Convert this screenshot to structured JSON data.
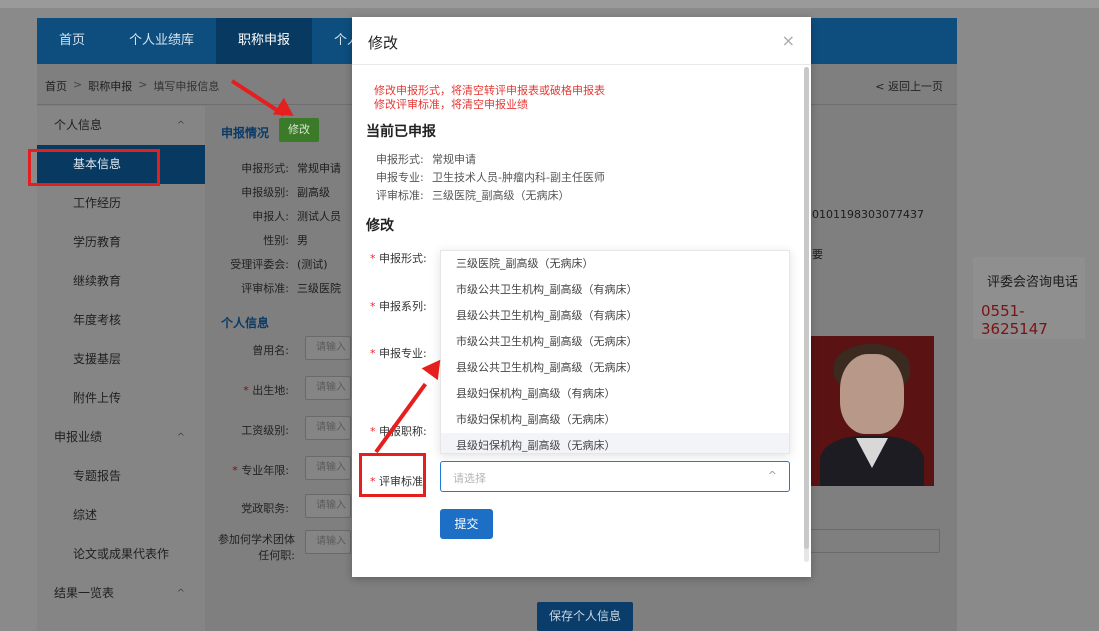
{
  "nav": {
    "items": [
      "首页",
      "个人业绩库",
      "职称申报",
      "个人中心"
    ],
    "active_index": 2
  },
  "breadcrumb": {
    "home": "首页",
    "sep": ">",
    "section": "职称申报",
    "current": "填写申报信息"
  },
  "back_link": "< 返回上一页",
  "sidebar": {
    "groups": [
      {
        "label": "个人信息",
        "chevron": "^",
        "items": [
          "基本信息",
          "工作经历",
          "学历教育",
          "继续教育",
          "年度考核",
          "支援基层",
          "附件上传"
        ]
      },
      {
        "label": "申报业绩",
        "chevron": "^",
        "items": [
          "专题报告",
          "综述",
          "论文或成果代表作"
        ]
      },
      {
        "label": "结果一览表",
        "chevron": "^",
        "items": []
      }
    ],
    "active_item": "基本信息"
  },
  "main": {
    "section_title": "申报情况",
    "edit_button": "修改",
    "fields": [
      {
        "label": "申报形式:",
        "value": "常规申请"
      },
      {
        "label": "申报级别:",
        "value": "副高级"
      },
      {
        "label": "申报人:",
        "value": "测试人员"
      },
      {
        "label": "性别:",
        "value": "男"
      },
      {
        "label": "受理评委会:",
        "value": "(测试)"
      },
      {
        "label": "评审标准:",
        "value": "三级医院"
      }
    ],
    "personal_title": "个人信息",
    "personal_fields": [
      {
        "label": "曾用名:",
        "required": false,
        "placeholder": "请输入"
      },
      {
        "label": "出生地:",
        "required": true,
        "placeholder": "请输入"
      },
      {
        "label": "工资级别:",
        "required": false,
        "placeholder": "请输入"
      },
      {
        "label": "专业年限:",
        "required": true,
        "placeholder": "请输入"
      },
      {
        "label": "党政职务:",
        "required": false,
        "placeholder": "请输入"
      },
      {
        "label": "参加何学术团体任何职:",
        "required": false,
        "placeholder": "请输入"
      }
    ],
    "id_number": "0101198303077437",
    "requirement": "要",
    "save_button": "保存个人信息"
  },
  "consult": {
    "title": "评委会咨询电话",
    "phone": "0551-3625147"
  },
  "modal": {
    "title": "修改",
    "close": "×",
    "warnings": [
      "修改申报形式，将清空转评申报表或破格申报表",
      "修改评审标准，将清空申报业绩"
    ],
    "current_heading": "当前已申报",
    "current": [
      {
        "label": "申报形式:",
        "value": "常规申请"
      },
      {
        "label": "申报专业:",
        "value": "卫生技术人员-肿瘤内科-副主任医师"
      },
      {
        "label": "评审标准:",
        "value": "三级医院_副高级（无病床）"
      }
    ],
    "edit_heading": "修改",
    "form_labels": [
      "申报形式:",
      "申报系列:",
      "申报专业:",
      "申报职称:",
      "评审标准"
    ],
    "required_mark": "*",
    "select_placeholder": "请选择",
    "select_arrow": "^",
    "dropdown_options": [
      "三级医院_副高级（无病床）",
      "市级公共卫生机构_副高级（有病床）",
      "县级公共卫生机构_副高级（有病床）",
      "市级公共卫生机构_副高级（无病床）",
      "县级公共卫生机构_副高级（无病床）",
      "县级妇保机构_副高级（有病床）",
      "市级妇保机构_副高级（无病床）",
      "县级妇保机构_副高级（无病床）"
    ],
    "submit_button": "提交"
  },
  "annotation_color": "#e51e1e"
}
